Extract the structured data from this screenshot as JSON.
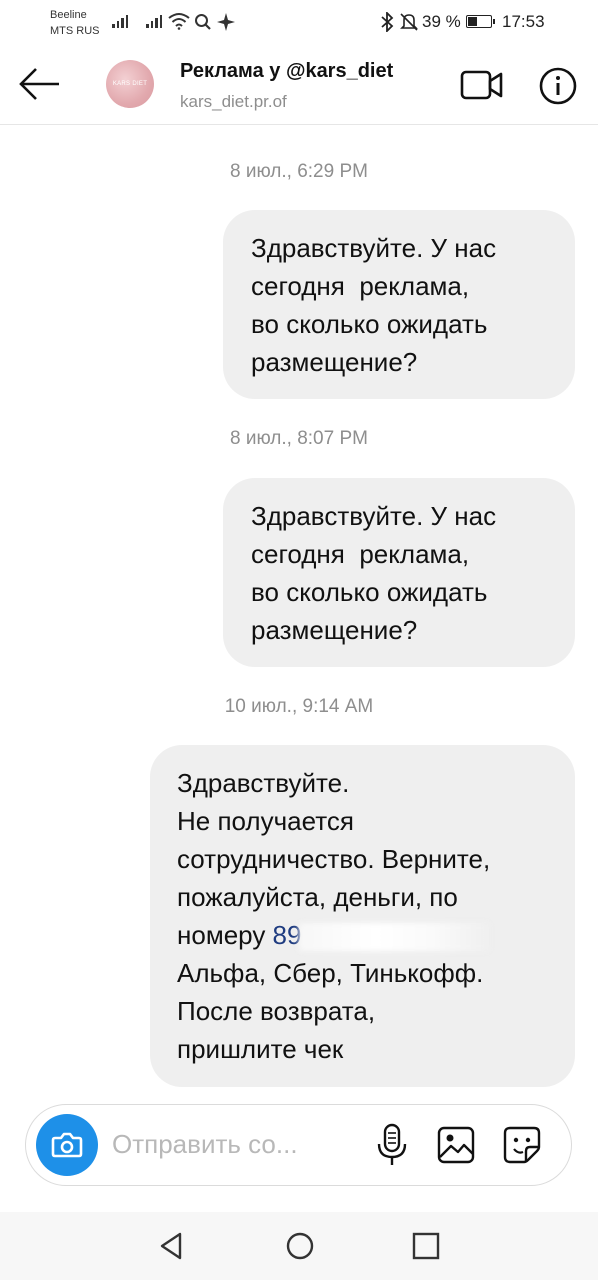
{
  "status_bar": {
    "carrier_1": "Beeline",
    "carrier_2": "MTS RUS",
    "battery_percent": "39 %",
    "battery_level": 0.39,
    "time": "17:53",
    "icons": [
      "signal-icon",
      "signal-icon",
      "wifi-icon",
      "search-icon",
      "sparkle-icon",
      "bluetooth-icon",
      "mute-icon",
      "battery-icon"
    ]
  },
  "header": {
    "title": "Реклама у @kars_diet",
    "subtitle": "kars_diet.pr.of",
    "avatar_text": "KARS DIET",
    "icons": [
      "back-arrow-icon",
      "video-call-icon",
      "info-icon"
    ]
  },
  "messages": [
    {
      "timestamp": "8 июл., 6:29 PM",
      "lines": [
        "Здравствуйте. У нас",
        "сегодня  реклама,",
        "во сколько ожидать",
        "размещение?"
      ]
    },
    {
      "timestamp": "8 июл., 8:07 PM",
      "lines": [
        "Здравствуйте. У нас",
        "сегодня  реклама,",
        "во сколько ожидать",
        "размещение?"
      ]
    },
    {
      "timestamp": "10 июл., 9:14 AM",
      "lines": [
        "Здравствуйте.",
        "Не получается",
        "сотрудничество. Верните,",
        "пожалуйста, деньги, по"
      ],
      "phone_prefix": "номеру ",
      "phone_visible": "89",
      "lines_after": [
        "Альфа, Сбер, Тинькофф.",
        "После возврата,",
        "пришлите чек"
      ]
    }
  ],
  "composer": {
    "placeholder": "Отправить со...",
    "accent_color": "#1e90e8",
    "icons": [
      "camera-icon",
      "microphone-icon",
      "gallery-icon",
      "sticker-icon"
    ]
  },
  "navbar": {
    "icons": [
      "nav-back-icon",
      "nav-home-icon",
      "nav-recents-icon"
    ]
  }
}
